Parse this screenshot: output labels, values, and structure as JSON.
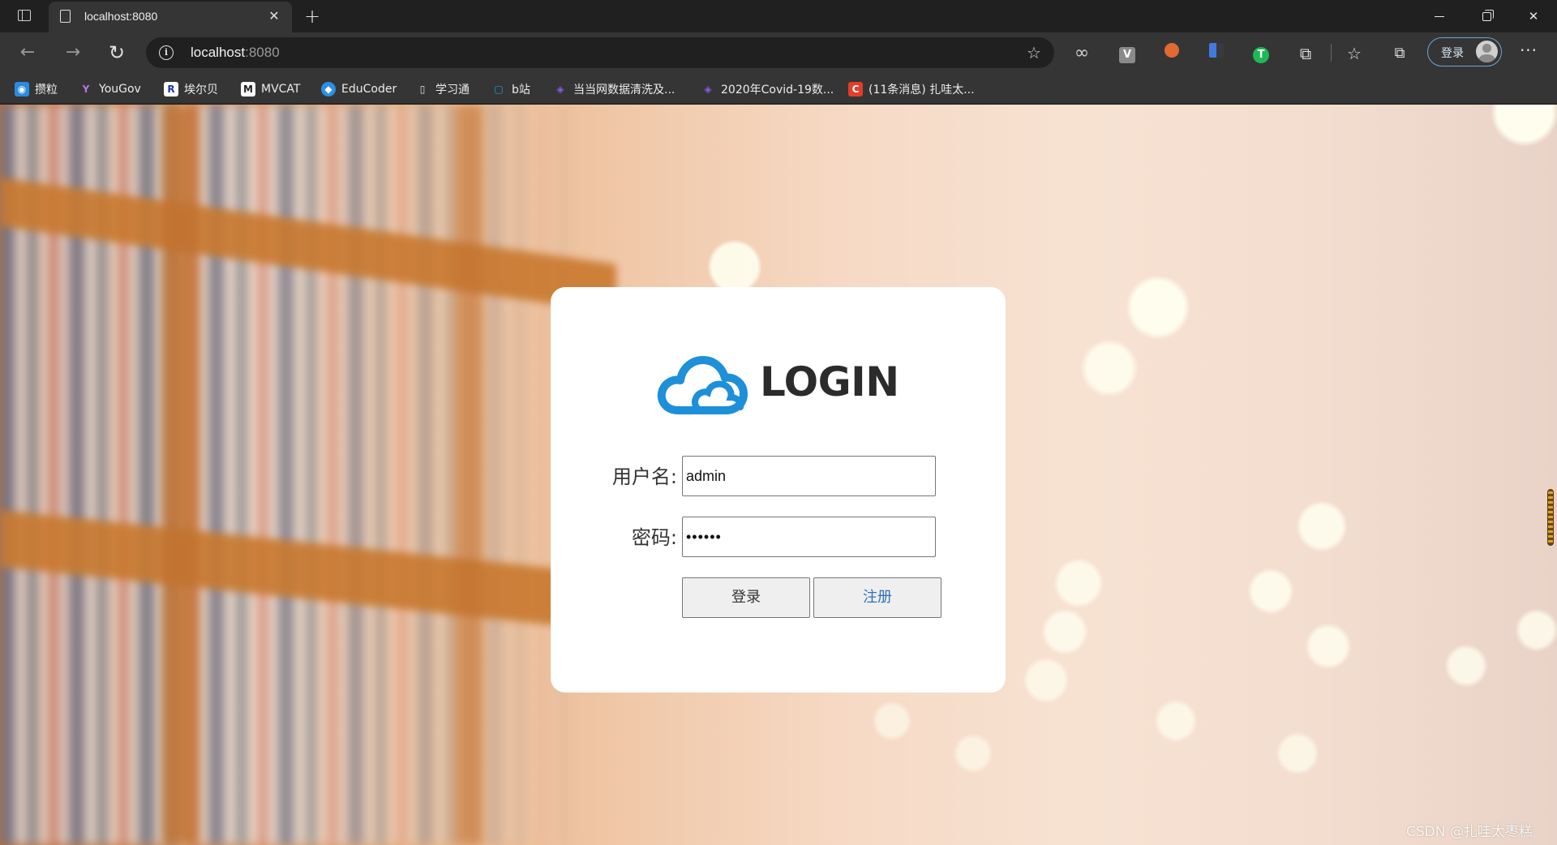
{
  "tab": {
    "title": "localhost:8080",
    "close_glyph": "✕"
  },
  "window": {
    "new_tab_glyph": "+",
    "close_glyph": "✕"
  },
  "toolbar": {
    "back_glyph": "←",
    "forward_glyph": "→",
    "reload_glyph": "↻",
    "info_glyph": "i",
    "url_host": "localhost",
    "url_port": ":8080",
    "fav_add_glyph": "☆",
    "infinity_glyph": "∞",
    "v_ext_label": "V",
    "t_ext_label": "T",
    "puzzle_glyph": "⧉",
    "favorites_glyph": "☆",
    "collections_glyph": "⧉",
    "signin_label": "登录",
    "more_glyph": "···"
  },
  "bookmarks": [
    {
      "label": "攒粒",
      "icon": "zanli-icon",
      "color": "#2a8be0",
      "glyph": "◉"
    },
    {
      "label": "YouGov",
      "icon": "yougov-icon",
      "color": "#8a4ad0",
      "glyph": "Y"
    },
    {
      "label": "埃尔贝",
      "icon": "r-icon",
      "color": "#1a3a9a",
      "glyph": "R"
    },
    {
      "label": "MVCAT",
      "icon": "mvcat-icon",
      "color": "#222222",
      "glyph": "M"
    },
    {
      "label": "EduCoder",
      "icon": "educoder-icon",
      "color": "#2c8fe6",
      "glyph": "◆"
    },
    {
      "label": "学习通",
      "icon": "page-icon",
      "color": "#353535",
      "glyph": "▯"
    },
    {
      "label": "b站",
      "icon": "bilibili-icon",
      "color": "#1da0e0",
      "glyph": "▢"
    },
    {
      "label": "当当网数据清洗及...",
      "icon": "cube-icon",
      "color": "#7b4ad8",
      "glyph": "◈"
    },
    {
      "label": "2020年Covid-19数...",
      "icon": "cube-icon",
      "color": "#7b4ad8",
      "glyph": "◈"
    },
    {
      "label": "(11条消息) 扎哇太...",
      "icon": "csdn-icon",
      "color": "#e33e2c",
      "glyph": "C"
    }
  ],
  "login": {
    "logo_text": "LOGIN",
    "username_label": "用户名:",
    "username_value": "admin",
    "password_label": "密码:",
    "password_value": "••••••",
    "login_button": "登录",
    "register_button": "注册"
  },
  "colors": {
    "cloud_blue": "#1e8fd9",
    "register_text": "#2f6fb8",
    "signin_border": "#6fa3d9"
  },
  "watermark": "CSDN @扎哇太枣糕"
}
